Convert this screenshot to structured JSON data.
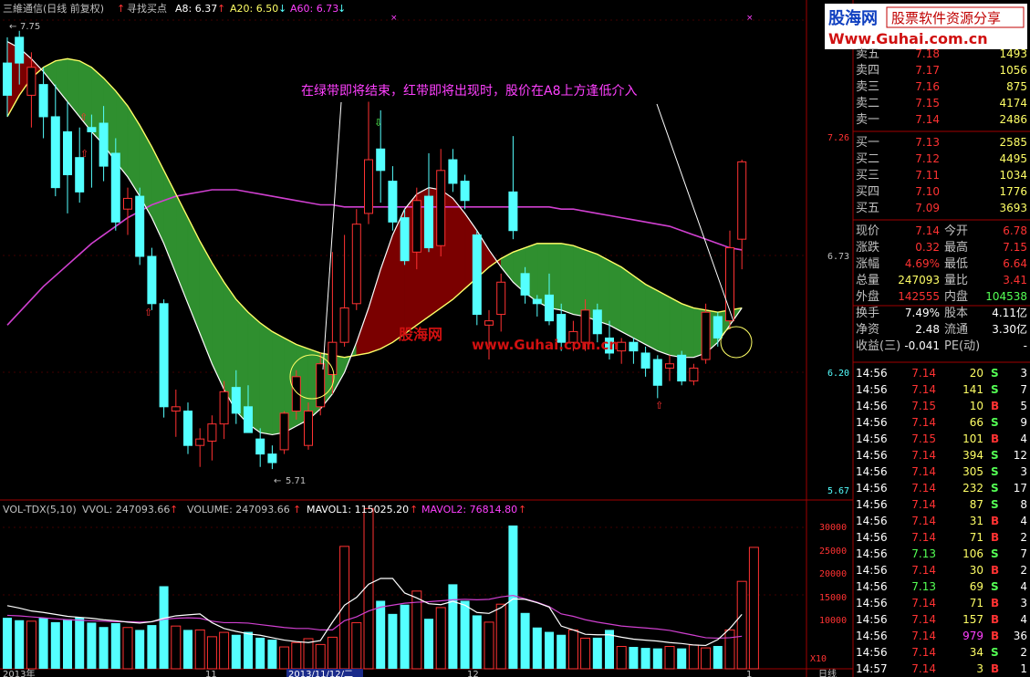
{
  "header": {
    "stock": "三維通信(日线 前复权)",
    "indicator": "寻找买点",
    "a8": "A8: 6.37",
    "a20": "A20: 6.50",
    "a60": "A60: 6.73"
  },
  "logo": {
    "brand": "股海网",
    "slogan": "股票软件资源分享",
    "url": "Www.Guhai.com.cn"
  },
  "annotation": "在绿带即将结束，红带即将出现时，股价在A8上方逢低介入",
  "watermark_cn": "股海网",
  "watermark_url": "www.Guhai.com.cn",
  "price_axis": {
    "labels": [
      "7.26",
      "6.73",
      "6.20",
      "5.67"
    ]
  },
  "price_marks": {
    "high": "7.75",
    "low": "5.71"
  },
  "volume_panel": {
    "title": "VOL-TDX(5,10)",
    "vvol": "VVOL: 247093.66",
    "volume": "VOLUME: 247093.66",
    "mavol1": "MAVOL1: 115025.20",
    "mavol2": "MAVOL2: 76814.80",
    "axis_labels": [
      "30000",
      "25000",
      "20000",
      "15000",
      "10000"
    ],
    "unit": "X10"
  },
  "date_axis": {
    "labels": [
      "2013年",
      "11",
      "2013/11/12/二",
      "12",
      "1"
    ],
    "period": "日线"
  },
  "order_book": {
    "asks": [
      {
        "label": "卖五",
        "price": "7.18",
        "vol": "1493"
      },
      {
        "label": "卖四",
        "price": "7.17",
        "vol": "1056"
      },
      {
        "label": "卖三",
        "price": "7.16",
        "vol": "875"
      },
      {
        "label": "卖二",
        "price": "7.15",
        "vol": "4174"
      },
      {
        "label": "卖一",
        "price": "7.14",
        "vol": "2486"
      }
    ],
    "bids": [
      {
        "label": "买一",
        "price": "7.13",
        "vol": "2585"
      },
      {
        "label": "买二",
        "price": "7.12",
        "vol": "4495"
      },
      {
        "label": "买三",
        "price": "7.11",
        "vol": "1034"
      },
      {
        "label": "买四",
        "price": "7.10",
        "vol": "1776"
      },
      {
        "label": "买五",
        "price": "7.09",
        "vol": "3693"
      }
    ]
  },
  "quote": [
    {
      "l1": "现价",
      "v1": "7.14",
      "l2": "今开",
      "v2": "6.78"
    },
    {
      "l1": "涨跌",
      "v1": "0.32",
      "l2": "最高",
      "v2": "7.15"
    },
    {
      "l1": "涨幅",
      "v1": "4.69%",
      "l2": "最低",
      "v2": "6.64"
    },
    {
      "l1": "总量",
      "v1": "247093",
      "l2": "量比",
      "v2": "3.41"
    },
    {
      "l1": "外盘",
      "v1": "142555",
      "l2": "内盘",
      "v2": "104538"
    },
    {
      "l1": "换手",
      "v1": "7.49%",
      "l2": "股本",
      "v2": "4.11亿"
    },
    {
      "l1": "净资",
      "v1": "2.48",
      "l2": "流通",
      "v2": "3.30亿"
    },
    {
      "l1": "收益(三)",
      "v1": "-0.041",
      "l2": "PE(动)",
      "v2": "-"
    }
  ],
  "ticks": [
    {
      "time": "14:56",
      "price": "7.14",
      "vol": "20",
      "side": "S",
      "n": "3"
    },
    {
      "time": "14:56",
      "price": "7.14",
      "vol": "141",
      "side": "S",
      "n": "7"
    },
    {
      "time": "14:56",
      "price": "7.15",
      "vol": "10",
      "side": "B",
      "n": "5"
    },
    {
      "time": "14:56",
      "price": "7.14",
      "vol": "66",
      "side": "S",
      "n": "9"
    },
    {
      "time": "14:56",
      "price": "7.15",
      "vol": "101",
      "side": "B",
      "n": "4"
    },
    {
      "time": "14:56",
      "price": "7.14",
      "vol": "394",
      "side": "S",
      "n": "12"
    },
    {
      "time": "14:56",
      "price": "7.14",
      "vol": "305",
      "side": "S",
      "n": "3"
    },
    {
      "time": "14:56",
      "price": "7.14",
      "vol": "232",
      "side": "S",
      "n": "17"
    },
    {
      "time": "14:56",
      "price": "7.14",
      "vol": "87",
      "side": "S",
      "n": "8"
    },
    {
      "time": "14:56",
      "price": "7.14",
      "vol": "31",
      "side": "B",
      "n": "4"
    },
    {
      "time": "14:56",
      "price": "7.14",
      "vol": "71",
      "side": "B",
      "n": "2"
    },
    {
      "time": "14:56",
      "price": "7.13",
      "vol": "106",
      "side": "S",
      "n": "7"
    },
    {
      "time": "14:56",
      "price": "7.14",
      "vol": "30",
      "side": "B",
      "n": "2"
    },
    {
      "time": "14:56",
      "price": "7.13",
      "vol": "69",
      "side": "S",
      "n": "4"
    },
    {
      "time": "14:56",
      "price": "7.14",
      "vol": "71",
      "side": "B",
      "n": "3"
    },
    {
      "time": "14:56",
      "price": "7.14",
      "vol": "157",
      "side": "B",
      "n": "4"
    },
    {
      "time": "14:56",
      "price": "7.14",
      "vol": "979",
      "side": "B",
      "n": "36"
    },
    {
      "time": "14:56",
      "price": "7.14",
      "vol": "34",
      "side": "S",
      "n": "2"
    },
    {
      "time": "14:57",
      "price": "7.14",
      "vol": "3",
      "side": "B",
      "n": "1"
    }
  ],
  "colors": {
    "up": "#ff3232",
    "down": "#54ffff",
    "green_band": "#2f8f2f",
    "red_band": "#7a0000",
    "ma8": "#ffffff",
    "ma20": "#ffff66",
    "ma60": "#d040d0",
    "label": "#c0c0c0",
    "accent": "#ff40ff"
  },
  "chart_data": [
    {
      "type": "candlestick",
      "title": "三維通信(日线 前复权)",
      "ylim": [
        5.6,
        7.8
      ],
      "ticks": [
        7.26,
        6.73,
        6.2,
        5.67
      ],
      "candles": [
        {
          "o": 7.6,
          "h": 7.72,
          "l": 7.35,
          "c": 7.45
        },
        {
          "o": 7.72,
          "h": 7.75,
          "l": 7.5,
          "c": 7.6
        },
        {
          "o": 7.45,
          "h": 7.65,
          "l": 7.3,
          "c": 7.58
        },
        {
          "o": 7.5,
          "h": 7.58,
          "l": 7.25,
          "c": 7.35
        },
        {
          "o": 7.35,
          "h": 7.5,
          "l": 6.98,
          "c": 7.02
        },
        {
          "o": 7.28,
          "h": 7.42,
          "l": 6.9,
          "c": 7.08
        },
        {
          "o": 7.16,
          "h": 7.3,
          "l": 6.95,
          "c": 7.0
        },
        {
          "o": 7.3,
          "h": 7.36,
          "l": 7.02,
          "c": 7.28
        },
        {
          "o": 7.32,
          "h": 7.4,
          "l": 7.05,
          "c": 7.12
        },
        {
          "o": 7.18,
          "h": 7.25,
          "l": 6.82,
          "c": 6.86
        },
        {
          "o": 6.92,
          "h": 7.02,
          "l": 6.8,
          "c": 6.97
        },
        {
          "o": 6.98,
          "h": 7.02,
          "l": 6.66,
          "c": 6.7
        },
        {
          "o": 6.7,
          "h": 6.74,
          "l": 6.45,
          "c": 6.48
        },
        {
          "o": 6.48,
          "h": 6.5,
          "l": 5.95,
          "c": 6.0
        },
        {
          "o": 5.98,
          "h": 6.08,
          "l": 5.86,
          "c": 6.0
        },
        {
          "o": 5.98,
          "h": 6.02,
          "l": 5.78,
          "c": 5.82
        },
        {
          "o": 5.82,
          "h": 5.9,
          "l": 5.72,
          "c": 5.85
        },
        {
          "o": 5.84,
          "h": 5.96,
          "l": 5.75,
          "c": 5.92
        },
        {
          "o": 5.92,
          "h": 6.12,
          "l": 5.85,
          "c": 6.07
        },
        {
          "o": 6.09,
          "h": 6.17,
          "l": 5.92,
          "c": 5.97
        },
        {
          "o": 6.0,
          "h": 6.1,
          "l": 5.9,
          "c": 5.88
        },
        {
          "o": 5.85,
          "h": 5.9,
          "l": 5.72,
          "c": 5.78
        },
        {
          "o": 5.78,
          "h": 5.82,
          "l": 5.71,
          "c": 5.74
        },
        {
          "o": 5.8,
          "h": 5.98,
          "l": 5.78,
          "c": 5.97
        },
        {
          "o": 5.98,
          "h": 6.17,
          "l": 5.94,
          "c": 6.14
        },
        {
          "o": 5.82,
          "h": 6.02,
          "l": 5.8,
          "c": 5.98
        },
        {
          "o": 6.0,
          "h": 6.25,
          "l": 5.96,
          "c": 6.2
        },
        {
          "o": 6.15,
          "h": 6.72,
          "l": 6.06,
          "c": 6.3
        },
        {
          "o": 6.3,
          "h": 6.8,
          "l": 6.28,
          "c": 6.46
        },
        {
          "o": 6.48,
          "h": 6.92,
          "l": 6.45,
          "c": 6.85
        },
        {
          "o": 6.9,
          "h": 7.42,
          "l": 6.85,
          "c": 7.15
        },
        {
          "o": 7.2,
          "h": 7.38,
          "l": 6.95,
          "c": 7.1
        },
        {
          "o": 7.05,
          "h": 7.12,
          "l": 6.82,
          "c": 6.86
        },
        {
          "o": 6.88,
          "h": 6.92,
          "l": 6.66,
          "c": 6.68
        },
        {
          "o": 6.72,
          "h": 7.02,
          "l": 6.64,
          "c": 6.96
        },
        {
          "o": 6.98,
          "h": 7.18,
          "l": 6.72,
          "c": 6.74
        },
        {
          "o": 6.75,
          "h": 7.2,
          "l": 6.7,
          "c": 7.1
        },
        {
          "o": 7.15,
          "h": 7.2,
          "l": 7.0,
          "c": 7.04
        },
        {
          "o": 7.05,
          "h": 7.08,
          "l": 6.92,
          "c": 6.96
        },
        {
          "o": 6.8,
          "h": 6.82,
          "l": 6.38,
          "c": 6.43
        },
        {
          "o": 6.38,
          "h": 6.45,
          "l": 6.22,
          "c": 6.4
        },
        {
          "o": 6.43,
          "h": 6.62,
          "l": 6.35,
          "c": 6.58
        },
        {
          "o": 7.0,
          "h": 7.26,
          "l": 6.78,
          "c": 6.82
        },
        {
          "o": 6.62,
          "h": 6.65,
          "l": 6.48,
          "c": 6.52
        },
        {
          "o": 6.5,
          "h": 6.52,
          "l": 6.42,
          "c": 6.48
        },
        {
          "o": 6.52,
          "h": 6.62,
          "l": 6.38,
          "c": 6.4
        },
        {
          "o": 6.43,
          "h": 6.48,
          "l": 6.26,
          "c": 6.3
        },
        {
          "o": 6.3,
          "h": 6.4,
          "l": 6.26,
          "c": 6.35
        },
        {
          "o": 6.3,
          "h": 6.5,
          "l": 6.26,
          "c": 6.45
        },
        {
          "o": 6.45,
          "h": 6.48,
          "l": 6.3,
          "c": 6.34
        },
        {
          "o": 6.32,
          "h": 6.4,
          "l": 6.22,
          "c": 6.25
        },
        {
          "o": 6.26,
          "h": 6.32,
          "l": 6.2,
          "c": 6.3
        },
        {
          "o": 6.3,
          "h": 6.32,
          "l": 6.2,
          "c": 6.26
        },
        {
          "o": 6.25,
          "h": 6.28,
          "l": 6.14,
          "c": 6.18
        },
        {
          "o": 6.22,
          "h": 6.24,
          "l": 6.04,
          "c": 6.1
        },
        {
          "o": 6.18,
          "h": 6.24,
          "l": 6.12,
          "c": 6.2
        },
        {
          "o": 6.24,
          "h": 6.26,
          "l": 6.1,
          "c": 6.12
        },
        {
          "o": 6.12,
          "h": 6.2,
          "l": 6.1,
          "c": 6.18
        },
        {
          "o": 6.22,
          "h": 6.48,
          "l": 6.2,
          "c": 6.44
        },
        {
          "o": 6.42,
          "h": 6.44,
          "l": 6.28,
          "c": 6.32
        },
        {
          "o": 6.4,
          "h": 6.82,
          "l": 6.36,
          "c": 6.74
        },
        {
          "o": 6.78,
          "h": 7.15,
          "l": 6.64,
          "c": 7.14
        }
      ],
      "ma8": [
        7.7,
        7.67,
        7.62,
        7.56,
        7.49,
        7.42,
        7.35,
        7.28,
        7.22,
        7.14,
        7.07,
        6.98,
        6.88,
        6.76,
        6.62,
        6.48,
        6.34,
        6.2,
        6.08,
        5.98,
        5.92,
        5.88,
        5.87,
        5.88,
        5.91,
        5.94,
        5.99,
        6.06,
        6.16,
        6.3,
        6.46,
        6.64,
        6.8,
        6.92,
        6.99,
        7.02,
        7.01,
        6.97,
        6.9,
        6.82,
        6.73,
        6.65,
        6.58,
        6.53,
        6.49,
        6.46,
        6.45,
        6.43,
        6.42,
        6.4,
        6.38,
        6.35,
        6.32,
        6.29,
        6.26,
        6.24,
        6.23,
        6.23,
        6.25,
        6.3,
        6.38,
        6.46
      ],
      "ma20": [
        7.35,
        7.45,
        7.53,
        7.58,
        7.61,
        7.62,
        7.61,
        7.58,
        7.53,
        7.47,
        7.4,
        7.31,
        7.21,
        7.1,
        6.99,
        6.88,
        6.77,
        6.67,
        6.58,
        6.5,
        6.44,
        6.39,
        6.35,
        6.32,
        6.29,
        6.27,
        6.25,
        6.24,
        6.23,
        6.24,
        6.25,
        6.27,
        6.3,
        6.34,
        6.38,
        6.42,
        6.46,
        6.5,
        6.55,
        6.6,
        6.65,
        6.69,
        6.72,
        6.74,
        6.76,
        6.76,
        6.76,
        6.75,
        6.73,
        6.71,
        6.68,
        6.65,
        6.61,
        6.57,
        6.54,
        6.51,
        6.48,
        6.46,
        6.45,
        6.44,
        6.45,
        6.46
      ],
      "ma60": [
        6.38,
        6.44,
        6.5,
        6.56,
        6.61,
        6.66,
        6.71,
        6.76,
        6.8,
        6.84,
        6.88,
        6.91,
        6.94,
        6.96,
        6.98,
        6.99,
        7.0,
        7.01,
        7.01,
        7.01,
        7.0,
        6.99,
        6.98,
        6.97,
        6.96,
        6.95,
        6.94,
        6.94,
        6.93,
        6.93,
        6.93,
        6.93,
        6.93,
        6.93,
        6.93,
        6.93,
        6.93,
        6.93,
        6.93,
        6.93,
        6.93,
        6.93,
        6.93,
        6.93,
        6.93,
        6.93,
        6.92,
        6.92,
        6.91,
        6.9,
        6.89,
        6.88,
        6.87,
        6.86,
        6.85,
        6.84,
        6.82,
        6.8,
        6.78,
        6.76,
        6.74,
        6.73
      ]
    },
    {
      "type": "bar",
      "title": "VOL-TDX(5,10)",
      "ylim": [
        0,
        34000
      ],
      "ticks": [
        30000,
        25000,
        20000,
        15000,
        10000
      ],
      "volume": [
        10500,
        10000,
        9800,
        10500,
        9600,
        10200,
        10600,
        9500,
        8600,
        9400,
        8500,
        8000,
        9000,
        17000,
        8800,
        8000,
        8000,
        6600,
        7500,
        7000,
        7600,
        6400,
        6000,
        4500,
        5400,
        6200,
        5000,
        6500,
        25200,
        9500,
        33000,
        14000,
        11300,
        13200,
        16000,
        10300,
        12600,
        17400,
        14000,
        11000,
        9600,
        13300,
        29500,
        11500,
        8500,
        7600,
        7000,
        8000,
        6300,
        6400,
        8000,
        4600,
        4500,
        4300,
        4200,
        4600,
        4200,
        4900,
        4300,
        4700,
        8000,
        18000,
        25000
      ],
      "mavol1": [
        13000,
        12500,
        11900,
        11600,
        11200,
        10800,
        10600,
        10400,
        10100,
        9900,
        9600,
        9400,
        9700,
        10400,
        10900,
        11100,
        11300,
        9500,
        8300,
        7700,
        7200,
        6900,
        6400,
        5900,
        5600,
        5400,
        5800,
        9600,
        13100,
        14700,
        17400,
        18600,
        18600,
        15600,
        14600,
        13400,
        13200,
        13900,
        13100,
        11600,
        11400,
        12600,
        14400,
        14300,
        13600,
        12700,
        8800,
        8000,
        7100,
        7000,
        7000,
        6500,
        6100,
        5900,
        5700,
        5400,
        5200,
        4900,
        4800,
        6000,
        8300,
        11200
      ],
      "mavol2": [
        11000,
        10900,
        10700,
        10500,
        10300,
        10100,
        10000,
        9900,
        9800,
        9700,
        9700,
        9600,
        9700,
        10200,
        10400,
        10500,
        10400,
        9800,
        9500,
        9500,
        9400,
        9100,
        8800,
        8500,
        8300,
        8300,
        8000,
        8000,
        9900,
        10700,
        11900,
        12700,
        13100,
        13500,
        13700,
        13800,
        14000,
        14200,
        14300,
        14200,
        14300,
        14800,
        15100,
        14400,
        13700,
        12800,
        11300,
        10800,
        10100,
        9600,
        9200,
        8800,
        8600,
        8400,
        8200,
        7900,
        7400,
        6900,
        6400,
        6300,
        6400,
        6700
      ]
    }
  ]
}
